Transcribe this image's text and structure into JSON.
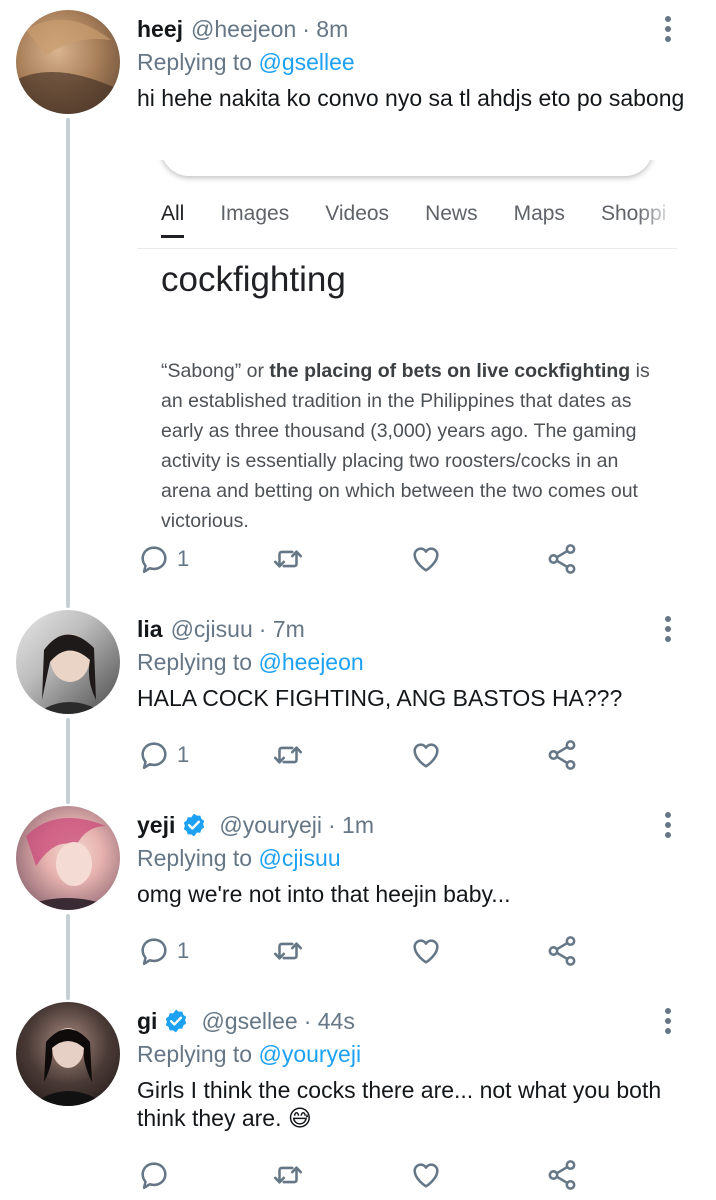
{
  "tweets": [
    {
      "name": "heej",
      "handle": "@heejeon",
      "time": "· 8m",
      "verified": false,
      "replying_label": "Replying to",
      "replying_to": "@gsellee",
      "text": "hi hehe nakita ko convo nyo sa tl ahdjs eto po sabong",
      "reply_count": "1",
      "embed": {
        "tabs": [
          "All",
          "Images",
          "Videos",
          "News",
          "Maps",
          "Shoppi"
        ],
        "active_tab": "All",
        "query": "cockfighting",
        "snippet_open_quote": "“Sabong” or ",
        "snippet_bold": "the placing of bets on live cockfighting",
        "snippet_rest": " is an established tradition in the Philippines that dates as early as three thousand (3,000) years ago. The gaming activity is essentially placing two roosters/cocks in an arena and betting on which between the two comes out victorious."
      }
    },
    {
      "name": "lia",
      "handle": "@cjisuu",
      "time": "· 7m",
      "verified": false,
      "replying_label": "Replying to",
      "replying_to": "@heejeon",
      "text": "HALA COCK FIGHTING, ANG BASTOS HA???",
      "reply_count": "1"
    },
    {
      "name": "yeji",
      "handle": "@youryeji",
      "time": "· 1m",
      "verified": true,
      "replying_label": "Replying to",
      "replying_to": "@cjisuu",
      "text": "omg we're not into that heejin baby...",
      "reply_count": "1"
    },
    {
      "name": "gi",
      "handle": "@gsellee",
      "time": "· 44s",
      "verified": true,
      "replying_label": "Replying to",
      "replying_to": "@youryeji",
      "text": "Girls I think the cocks there are... not what you both think they are. 😅",
      "reply_count": ""
    }
  ],
  "colors": {
    "accent": "#1da1f2",
    "secondary_text": "#657786",
    "thread_line": "#c4cfd6"
  },
  "icons": [
    "reply-icon",
    "retweet-icon",
    "like-icon",
    "share-icon",
    "more-icon",
    "verified-icon"
  ]
}
